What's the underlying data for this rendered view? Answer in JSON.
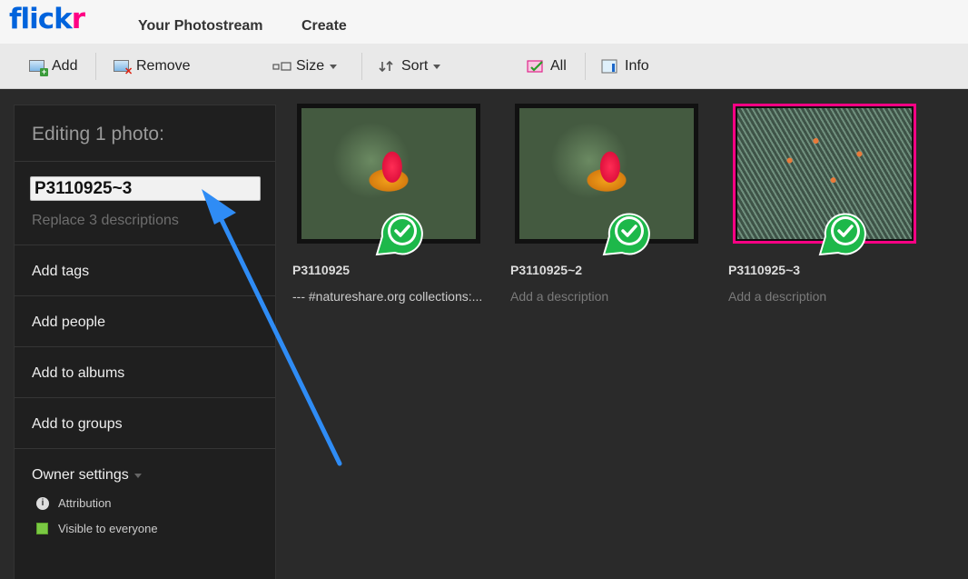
{
  "nav": {
    "logo_main": "flick",
    "logo_accent": "r",
    "links": [
      "Your Photostream",
      "Create"
    ]
  },
  "toolbar": {
    "add": "Add",
    "remove": "Remove",
    "size": "Size",
    "sort": "Sort",
    "all": "All",
    "info": "Info"
  },
  "sidebar": {
    "title": "Editing 1 photo:",
    "title_input_value": "P3110925~3",
    "replace_descriptions": "Replace 3 descriptions",
    "items": [
      "Add tags",
      "Add people",
      "Add to albums",
      "Add to groups"
    ],
    "owner_settings": "Owner settings",
    "attribution": "Attribution",
    "visibility": "Visible to everyone"
  },
  "photos": [
    {
      "name": "P3110925",
      "description": "--- #natureshare.org collections:...",
      "selected": false
    },
    {
      "name": "P3110925~2",
      "description": "Add a description",
      "selected": false
    },
    {
      "name": "P3110925~3",
      "description": "Add a description",
      "selected": true
    }
  ],
  "colors": {
    "flickr_blue": "#0063dc",
    "flickr_pink": "#ff0084",
    "check_green": "#1db84a",
    "annotation_arrow": "#2f8cf5"
  }
}
